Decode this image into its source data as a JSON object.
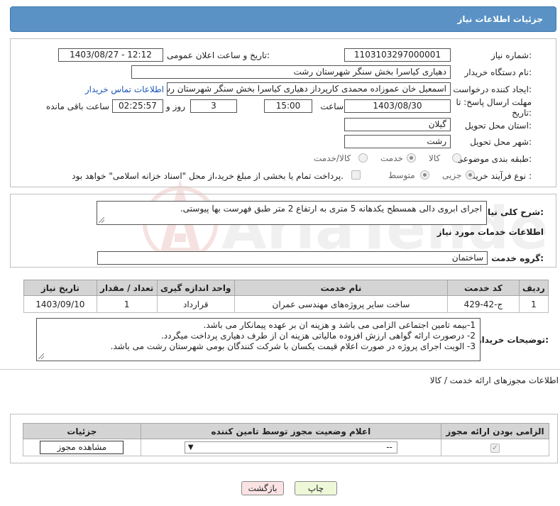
{
  "header": {
    "title": "جزئیات اطلاعات نیاز"
  },
  "form": {
    "need_number_label": "شماره نیاز:",
    "need_number": "1103103297000001",
    "announce_label": "تاریخ و ساعت اعلان عمومی:",
    "announce_value": "1403/08/27 - 12:12",
    "buyer_label": "نام دستگاه خریدار:",
    "buyer_value": "دهیاری کیاسرا بخش سنگر شهرستان رشت",
    "creator_label": "ایجاد کننده درخواست:",
    "creator_value": "اسمعیل خان عموزاده محمدی کارپرداز دهیاری کیاسرا بخش سنگر شهرستان رشت",
    "contact_link": "اطلاعات تماس خریدار",
    "deadline_label": "مهلت ارسال پاسخ: تا تاریخ:",
    "deadline_date": "1403/08/30",
    "time_label": "ساعت",
    "deadline_time": "15:00",
    "days_value": "3",
    "days_label": "روز و",
    "remaining_time": "02:25:57",
    "remaining_label": "ساعت باقی مانده",
    "province_label": "استان محل تحویل:",
    "province_value": "گیلان",
    "city_label": "شهر محل تحویل:",
    "city_value": "رشت",
    "category_label": "طبقه بندی موضوعی:",
    "category_options": [
      "کالا",
      "خدمت",
      "کالا/خدمت"
    ],
    "category_selected": "خدمت",
    "process_label": "نوع فرآیند خرید :",
    "process_options": [
      "جزیی",
      "متوسط"
    ],
    "process_selected": "جزیی",
    "treasury_note": "پرداخت تمام یا بخشی از مبلغ خرید،از محل \"اسناد خزانه اسلامی\" خواهد بود."
  },
  "summary": {
    "label": "شرح کلی نیاز:",
    "text": "اجرای ابروی دالی همسطح یکدهانه 5  متری  به ارتفاع 2 متر طبق فهرست بها پیوستی."
  },
  "services": {
    "section_title": "اطلاعات خدمات مورد نیاز",
    "group_label": "گروه خدمت:",
    "group_value": "ساختمان",
    "columns": [
      "ردیف",
      "کد خدمت",
      "نام خدمت",
      "واحد اندازه گیری",
      "تعداد / مقدار",
      "تاریخ نیاز"
    ],
    "rows": [
      {
        "row": "1",
        "code": "ج-42-429",
        "name": "ساخت سایر پروژه‌های مهندسی عمران",
        "unit": "قرارداد",
        "qty": "1",
        "date": "1403/09/10"
      }
    ]
  },
  "buyer_notes": {
    "label": "توضیحات خریدار:",
    "lines": [
      "1-بیمه تامین اجتماعی   الزامی می باشد و هزینه ان بر عهده پیمانکار  می باشد.",
      "2- درصورت ارائه گواهی ارزش افزوده مالیاتی هزینه ان از طرف دهیاری پرداخت میگردد.",
      "3- الویت اجرای پروژه در صورت اعلام  قیمت یکسان با شرکت کنندگان بومی شهرستان رشت می باشد."
    ]
  },
  "permits": {
    "title": "اطلاعات مجوزهای ارائه خدمت / کالا",
    "columns": [
      "الزامی بودن ارائه مجوز",
      "اعلام وضعیت مجوز توسط تامین کننده",
      "جزئیات"
    ],
    "select_value": "--",
    "view_button": "مشاهده مجوز"
  },
  "actions": {
    "print": "چاپ",
    "back": "بازگشت"
  },
  "watermark": {
    "text": "AriaTender.neT"
  },
  "colors": {
    "header": "#5a92c5",
    "link": "#1a56b8",
    "print_btn": "#eef8d9",
    "back_btn": "#fbe3e3"
  }
}
